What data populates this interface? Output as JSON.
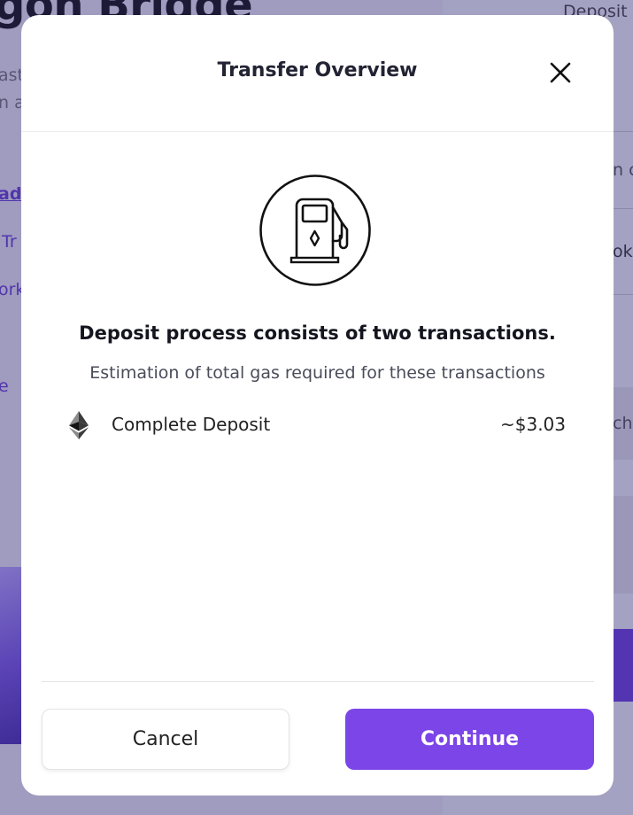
{
  "background": {
    "title_fragment": "gon Bridge",
    "text_fragments": [
      "ast",
      "n a",
      "adr",
      "Tr",
      "ork",
      "e"
    ],
    "right_fragments": [
      "Deposit",
      "n c",
      "oke",
      "cha"
    ]
  },
  "modal": {
    "title": "Transfer Overview",
    "close_icon": "close-icon",
    "illustration_icon": "gas-pump-icon",
    "headline": "Deposit process consists of two transactions.",
    "subline": "Estimation of total gas required for these transactions",
    "transactions": [
      {
        "icon": "ethereum-icon",
        "label": "Complete Deposit",
        "amount": "~$3.03"
      }
    ],
    "buttons": {
      "cancel": "Cancel",
      "continue": "Continue"
    }
  },
  "colors": {
    "accent": "#7b45e7",
    "overlay": "#2d286e"
  }
}
